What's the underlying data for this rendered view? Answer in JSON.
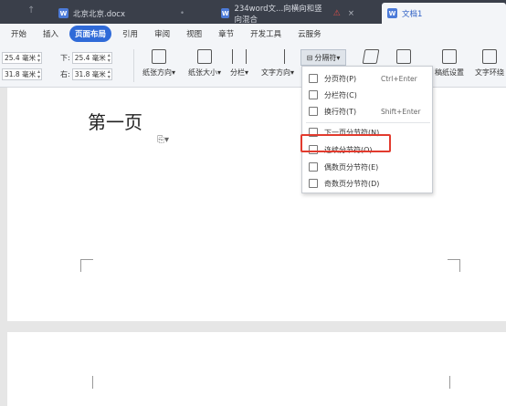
{
  "tabs": [
    {
      "label": "北京北京.docx",
      "active": false
    },
    {
      "label": "234word文...向横向和竖向混合",
      "active": false
    },
    {
      "label": "文档1",
      "active": true
    }
  ],
  "menu": [
    "开始",
    "插入",
    "页面布局",
    "引用",
    "审阅",
    "视图",
    "章节",
    "开发工具",
    "云服务"
  ],
  "margins": {
    "top": "25.4 毫米",
    "bottom_label": "下:",
    "bottom": "25.4 毫米",
    "left": "31.8 毫米",
    "right_label": "右:",
    "right": "31.8 毫米"
  },
  "ribbon": {
    "orientation": "纸张方向",
    "size": "纸张大小",
    "columns": "分栏",
    "text_direction": "文字方向",
    "breaks": "分隔符",
    "grid_settings": "稿纸设置",
    "wrap": "文字环绕"
  },
  "dropdown": {
    "items": [
      {
        "label": "分页符(P)",
        "shortcut": "Ctrl+Enter"
      },
      {
        "label": "分栏符(C)",
        "shortcut": ""
      },
      {
        "label": "换行符(T)",
        "shortcut": "Shift+Enter"
      },
      {
        "label": "下一页分节符(N)",
        "shortcut": ""
      },
      {
        "label": "连续分节符(O)",
        "shortcut": ""
      },
      {
        "label": "偶数页分节符(E)",
        "shortcut": ""
      },
      {
        "label": "奇数页分节符(D)",
        "shortcut": ""
      }
    ]
  },
  "document": {
    "title": "第一页"
  },
  "colors": {
    "accent": "#2f6ad8",
    "highlight": "#e23b2e"
  }
}
